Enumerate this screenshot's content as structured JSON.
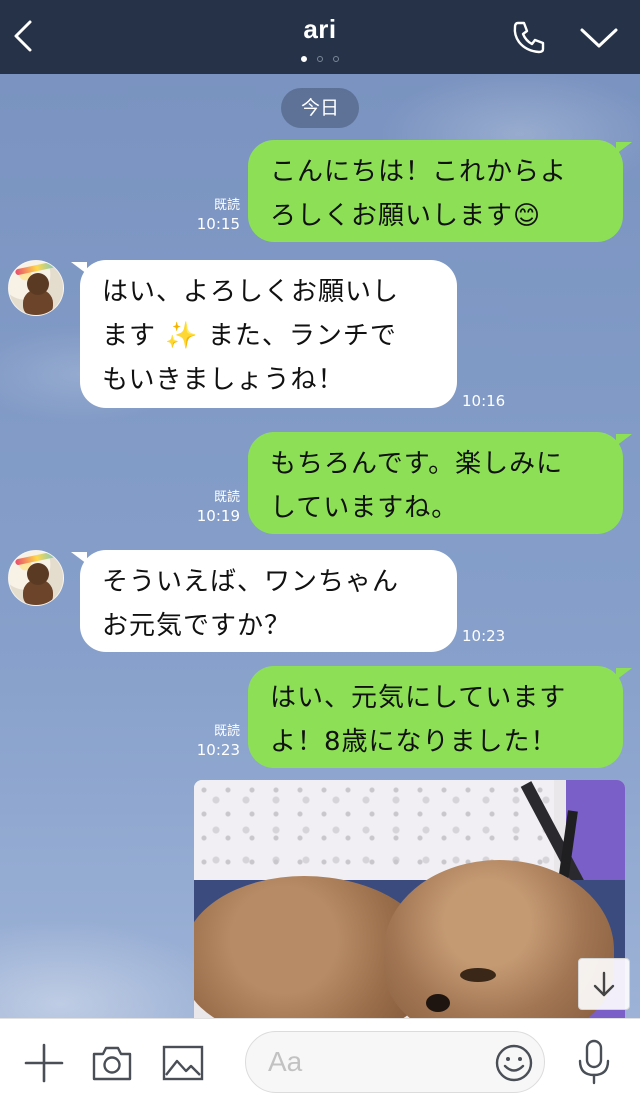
{
  "header": {
    "title": "ari",
    "page_indicator": {
      "count": 3,
      "active": 1
    }
  },
  "date_label": "今日",
  "messages": [
    {
      "side": "out",
      "lines": [
        "こんにちは！これからよ",
        "ろしくお願いします😊"
      ],
      "read": "既読",
      "time": "10:15"
    },
    {
      "side": "in",
      "lines": [
        "はい、よろしくお願いし",
        "ます ✨ また、ランチで",
        "もいきましょうね！"
      ],
      "time": "10:16"
    },
    {
      "side": "out",
      "lines": [
        "もちろんです。楽しみに",
        "していますね。"
      ],
      "read": "既読",
      "time": "10:19"
    },
    {
      "side": "in",
      "lines": [
        "そういえば、ワンちゃん",
        "お元気ですか？"
      ],
      "time": "10:23"
    },
    {
      "side": "out",
      "lines": [
        "はい、元気にしています",
        "よ！8歳になりました！"
      ],
      "read": "既読",
      "time": "10:23"
    }
  ],
  "photo_message": {
    "content": "dog-photo"
  },
  "input": {
    "placeholder": "Aa",
    "value": ""
  },
  "icons": [
    "back-arrow-icon",
    "phone-icon",
    "chevron-down-icon",
    "plus-icon",
    "camera-icon",
    "image-icon",
    "emoji-icon",
    "microphone-icon",
    "arrow-down-icon"
  ],
  "colors": {
    "header_bg": "#253248",
    "outgoing_bubble": "#8de055",
    "incoming_bubble": "#ffffff",
    "chat_bg": "#7f98c4"
  }
}
